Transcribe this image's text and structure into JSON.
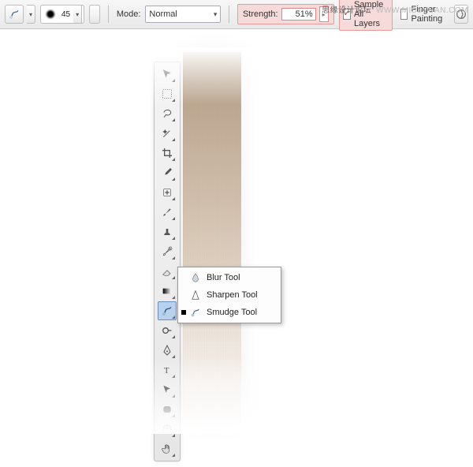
{
  "watermark": {
    "cn": "思缘设计论坛",
    "en": "WWW.MISSYUAN.COM"
  },
  "options": {
    "brush_size": "45",
    "mode_label": "Mode:",
    "mode_value": "Normal",
    "strength_label": "Strength:",
    "strength_value": "51%",
    "sample_all_label": "Sample All Layers",
    "sample_all_checked": "✓",
    "finger_label": "Finger Painting",
    "finger_checked": ""
  },
  "flyout": {
    "items": [
      {
        "label": "Blur Tool"
      },
      {
        "label": "Sharpen Tool"
      },
      {
        "label": "Smudge Tool"
      }
    ]
  }
}
